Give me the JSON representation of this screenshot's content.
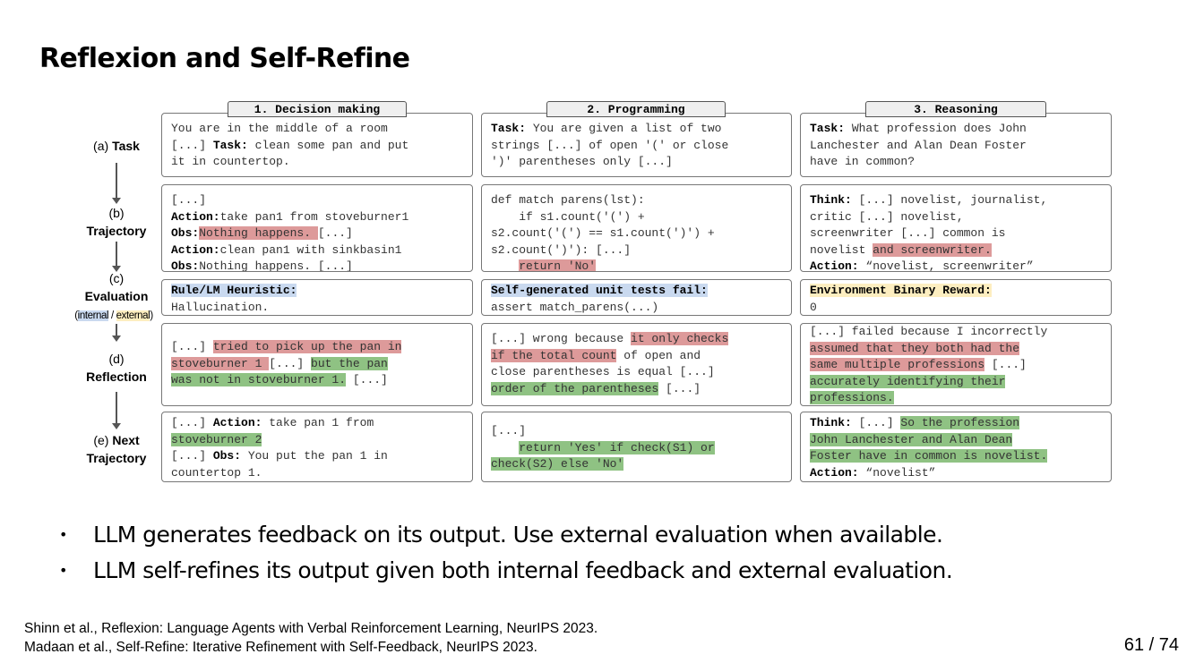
{
  "slide": {
    "title": "Reflexion and Self-Refine",
    "page_number": "61 / 74"
  },
  "figure": {
    "columns": [
      "1. Decision making",
      "2. Programming",
      "3. Reasoning"
    ],
    "rows": {
      "task": {
        "prefix": "(a)",
        "label": "Task"
      },
      "trajectory": {
        "prefix": "(b)",
        "label": "Trajectory"
      },
      "evaluation": {
        "prefix": "(c)",
        "label": "Evaluation",
        "internal": "internal",
        "separator": "/",
        "external": "external"
      },
      "reflection": {
        "prefix": "(d)",
        "label": "Reflection"
      },
      "next_trajectory": {
        "prefix": "(e)",
        "label_line1": "Next",
        "label_line2": "Trajectory"
      }
    },
    "cells": {
      "decision": {
        "task": {
          "intro": "You are in the middle of a room\n[...] ",
          "task_label": "Task:",
          "task_text": " clean some pan and put\nit in countertop."
        },
        "trajectory": {
          "line1": "[...]",
          "action1_label": "Action:",
          "action1_text": "take pan1 from stoveburner1",
          "obs1_label": "Obs:",
          "obs1_text": "Nothing happens. ",
          "obs1_tail": "[...]",
          "action2_label": "Action:",
          "action2_text": "clean pan1 with sinkbasin1",
          "obs2_label": "Obs:",
          "obs2_text": "Nothing happens. [...]"
        },
        "evaluation": {
          "label": "Rule/LM Heuristic:",
          "text": "Hallucination."
        },
        "reflection": {
          "p1": "[...] ",
          "r1": "tried to pick up the pan in",
          "r2": "stoveburner 1 ",
          "p2": "[...] ",
          "g1": "but the pan",
          "g2": "was not in stoveburner 1.",
          "p3": " [...]"
        },
        "next": {
          "p1": "[...] ",
          "action_label": "Action:",
          "action_text": " take pan 1 from",
          "g1": "stoveburner 2",
          "p2": "[...] ",
          "obs_label": "Obs:",
          "obs_text": " You put the pan 1 in\ncountertop 1."
        }
      },
      "programming": {
        "task": {
          "task_label": "Task:",
          "task_text": " You are given a list of two\nstrings [...] of open '(' or close\n')' parentheses only [...]"
        },
        "trajectory": {
          "code": "def match parens(lst):\n    if s1.count('(') +\ns2.count('(') == s1.count(')') +\ns2.count(')'): [...]\n    ",
          "return_line": "return 'No'"
        },
        "evaluation": {
          "label": "Self-generated unit tests fail:",
          "text": "assert match_parens(...)"
        },
        "reflection": {
          "p1": "[...] wrong because ",
          "r1": "it only checks",
          "r2": "if the total count",
          "p2": " of open and\nclose parentheses is equal [...]\n",
          "g1": "order of the parentheses",
          "p3": " [...]"
        },
        "next": {
          "p1": "[...]\n    ",
          "g1": "return 'Yes' if check(S1) or",
          "g2": "check(S2) else 'No'"
        }
      },
      "reasoning": {
        "task": {
          "task_label": "Task:",
          "task_text": " What profession does John\nLanchester and Alan Dean Foster\nhave in common?"
        },
        "trajectory": {
          "think_label": "Think:",
          "think_text": " [...] novelist, journalist,\ncritic [...] novelist,\nscreenwriter [...] common is\nnovelist ",
          "r1": "and screenwriter.",
          "action_label": "Action:",
          "action_text": " “novelist, screenwriter”"
        },
        "evaluation": {
          "label": "Environment Binary Reward:",
          "text": "0"
        },
        "reflection": {
          "p1": "[...] failed because I incorrectly\n",
          "r1": "assumed that they both had the",
          "r2": "same multiple professions",
          "p2": " [...]\n",
          "g1": "accurately identifying their",
          "g2": "professions."
        },
        "next": {
          "think_label": "Think:",
          "p1": " [...] ",
          "g1": "So the profession",
          "g2": "John Lanchester and Alan Dean",
          "g3": "Foster have in common is novelist.",
          "action_label": "Action:",
          "action_text": " “novelist”"
        }
      }
    }
  },
  "bullets": [
    "LLM generates feedback on its output. Use external evaluation when available.",
    "LLM self-refines its output given both internal feedback and external evaluation."
  ],
  "references": [
    "Shinn et al., Reflexion: Language Agents with Verbal Reinforcement Learning, NeurIPS 2023.",
    "Madaan et al., Self-Refine: Iterative Refinement with Self-Feedback, NeurIPS 2023."
  ]
}
